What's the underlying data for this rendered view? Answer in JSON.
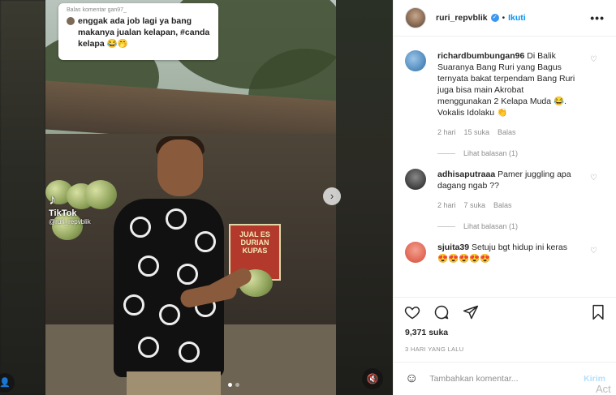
{
  "video": {
    "comment_overlay": {
      "reply_to": "Balas komentar gan97_",
      "text": "enggak ada job lagi ya bang makanya jualan kelapan, #canda kelapa 😂🤭"
    },
    "watermark": {
      "logo": "♪",
      "name": "TikTok",
      "handle": "@ruri_repvblik"
    },
    "stall_sign": "JUAL ES DURIAN KUPAS",
    "controls": {
      "next": "›",
      "mute": "🔇",
      "tag": "👤"
    }
  },
  "post": {
    "header": {
      "username": "ruri_repvblik",
      "separator": "•",
      "follow_label": "Ikuti",
      "more": "•••"
    },
    "comments": [
      {
        "username": "richardbumbungan96",
        "text": "Di Balik Suaranya Bang Ruri yang Bagus ternyata bakat terpendam Bang Ruri juga bisa main Akrobat menggunakan 2 Kelapa Muda 😂. Vokalis Idolaku 👏",
        "time": "2 hari",
        "likes": "15 suka",
        "reply": "Balas",
        "view_replies": "Lihat balasan (1)",
        "avatar_color": "#2b6fa8"
      },
      {
        "username": "adhisaputraaa",
        "text": "Pamer juggling apa dagang ngab ??",
        "time": "2 hari",
        "likes": "7 suka",
        "reply": "Balas",
        "view_replies": "Lihat balasan (1)",
        "avatar_color": "#2a2a2a"
      },
      {
        "username": "sjuita39",
        "text": "Setuju bgt hidup ini keras😍😍😍😍😍",
        "avatar_color": "#d84a3a"
      }
    ],
    "likes": "9,371 suka",
    "time_ago": "3 HARI YANG LALU",
    "add_comment": {
      "placeholder": "Tambahkan komentar...",
      "post_label": "Kirim"
    }
  },
  "os_overlay": {
    "activate_text": "Act"
  },
  "colors": {
    "accent": "#0095f6",
    "verified": "#3897f0"
  }
}
